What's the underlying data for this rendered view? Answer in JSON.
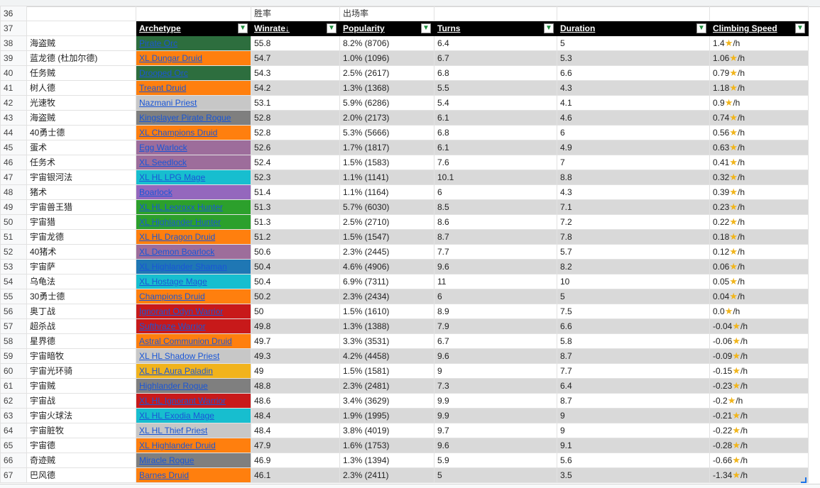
{
  "sub_headers": [
    "",
    "",
    "",
    "胜率",
    "出场率",
    "",
    "",
    ""
  ],
  "headers": [
    "Archetype",
    "Winrate↓",
    "Popularity",
    "Turns",
    "Duration",
    "Climbing Speed"
  ],
  "speed_suffix": "/h",
  "colors": {
    "dark_green": "#2d6e3e",
    "orange": "#ff7f0e",
    "light_gray": "#c7c7c7",
    "dark_gray": "#7f7f7f",
    "purple": "#9467bd",
    "mauve": "#9d6d9b",
    "cyan": "#17becf",
    "green": "#2ca02c",
    "steel_blue": "#1f77b4",
    "red": "#c8191a",
    "yellow": "#f1b31c"
  },
  "rows": [
    {
      "num": "36",
      "cn": "",
      "arch": "",
      "color": "",
      "winrate": "",
      "popularity": "",
      "turns": "",
      "duration": "",
      "speed": ""
    },
    {
      "num": "37",
      "cn": "",
      "header": true
    },
    {
      "num": "38",
      "cn": "海盗贼",
      "arch": "Pirate Orc",
      "color": "dark_green",
      "winrate": "55.8",
      "popularity": "8.2% (8706)",
      "turns": "6.4",
      "duration": "5",
      "speed": "1.4"
    },
    {
      "num": "39",
      "cn": "蓝龙德 (杜加尔德)",
      "arch": "XL Dungar Druid",
      "color": "orange",
      "winrate": "54.7",
      "popularity": "1.0% (1096)",
      "turns": "6.7",
      "duration": "5.3",
      "speed": "1.06"
    },
    {
      "num": "40",
      "cn": "任务贼",
      "arch": "Drooped Orc",
      "color": "dark_green",
      "winrate": "54.3",
      "popularity": "2.5% (2617)",
      "turns": "6.8",
      "duration": "6.6",
      "speed": "0.79"
    },
    {
      "num": "41",
      "cn": "树人德",
      "arch": "Treant Druid",
      "color": "orange",
      "winrate": "54.2",
      "popularity": "1.3% (1368)",
      "turns": "5.5",
      "duration": "4.3",
      "speed": "1.18"
    },
    {
      "num": "42",
      "cn": "光速牧",
      "arch": "Nazmani Priest",
      "color": "light_gray",
      "winrate": "53.1",
      "popularity": "5.9% (6286)",
      "turns": "5.4",
      "duration": "4.1",
      "speed": "0.9"
    },
    {
      "num": "43",
      "cn": "海盗贼",
      "arch": "Kingslayer Pirate Rogue",
      "color": "dark_gray",
      "winrate": "52.8",
      "popularity": "2.0% (2173)",
      "turns": "6.1",
      "duration": "4.6",
      "speed": "0.74"
    },
    {
      "num": "44",
      "cn": "40勇士德",
      "arch": "XL Champions Druid",
      "color": "orange",
      "winrate": "52.8",
      "popularity": "5.3% (5666)",
      "turns": "6.8",
      "duration": "6",
      "speed": "0.56"
    },
    {
      "num": "45",
      "cn": "蛋术",
      "arch": "Egg Warlock",
      "color": "mauve",
      "winrate": "52.6",
      "popularity": "1.7% (1817)",
      "turns": "6.1",
      "duration": "4.9",
      "speed": "0.63"
    },
    {
      "num": "46",
      "cn": "任务术",
      "arch": "XL Seedlock",
      "color": "mauve",
      "winrate": "52.4",
      "popularity": "1.5% (1583)",
      "turns": "7.6",
      "duration": "7",
      "speed": "0.41"
    },
    {
      "num": "47",
      "cn": "宇宙银河法",
      "arch": "XL HL LPG Mage",
      "color": "cyan",
      "winrate": "52.3",
      "popularity": "1.1% (1141)",
      "turns": "10.1",
      "duration": "8.8",
      "speed": "0.32"
    },
    {
      "num": "48",
      "cn": "猪术",
      "arch": "Boarlock",
      "color": "purple",
      "winrate": "51.4",
      "popularity": "1.1% (1164)",
      "turns": "6",
      "duration": "4.3",
      "speed": "0.39"
    },
    {
      "num": "49",
      "cn": "宇宙兽王猎",
      "arch": "XL HL Leoroxx Hunter",
      "color": "green",
      "winrate": "51.3",
      "popularity": "5.7% (6030)",
      "turns": "8.5",
      "duration": "7.1",
      "speed": "0.23"
    },
    {
      "num": "50",
      "cn": "宇宙猎",
      "arch": "XL Highlander Hunter",
      "color": "green",
      "winrate": "51.3",
      "popularity": "2.5% (2710)",
      "turns": "8.6",
      "duration": "7.2",
      "speed": "0.22"
    },
    {
      "num": "51",
      "cn": "宇宙龙德",
      "arch": "XL HL Dragon Druid",
      "color": "orange",
      "winrate": "51.2",
      "popularity": "1.5% (1547)",
      "turns": "8.7",
      "duration": "7.8",
      "speed": "0.18"
    },
    {
      "num": "52",
      "cn": "40猪术",
      "arch": "XL Demon Boarlock",
      "color": "mauve",
      "winrate": "50.6",
      "popularity": "2.3% (2445)",
      "turns": "7.7",
      "duration": "5.7",
      "speed": "0.12"
    },
    {
      "num": "53",
      "cn": "宇宙萨",
      "arch": "XL Highlander Shaman",
      "color": "steel_blue",
      "winrate": "50.4",
      "popularity": "4.6% (4906)",
      "turns": "9.6",
      "duration": "8.2",
      "speed": "0.06"
    },
    {
      "num": "54",
      "cn": "乌龟法",
      "arch": "XL Hostage Mage",
      "color": "cyan",
      "winrate": "50.4",
      "popularity": "6.9% (7311)",
      "turns": "11",
      "duration": "10",
      "speed": "0.05"
    },
    {
      "num": "55",
      "cn": "30勇士德",
      "arch": "Champions Druid",
      "color": "orange",
      "winrate": "50.2",
      "popularity": "2.3% (2434)",
      "turns": "6",
      "duration": "5",
      "speed": "0.04"
    },
    {
      "num": "56",
      "cn": "奥丁战",
      "arch": "Ignorant Odyn Warrior",
      "color": "red",
      "winrate": "50",
      "popularity": "1.5% (1610)",
      "turns": "8.9",
      "duration": "7.5",
      "speed": "0.0"
    },
    {
      "num": "57",
      "cn": "超杀战",
      "arch": "Sufthraze Warrior",
      "color": "red",
      "winrate": "49.8",
      "popularity": "1.3% (1388)",
      "turns": "7.9",
      "duration": "6.6",
      "speed": "-0.04"
    },
    {
      "num": "58",
      "cn": "星界德",
      "arch": "Astral Communion Druid",
      "color": "orange",
      "winrate": "49.7",
      "popularity": "3.3% (3531)",
      "turns": "6.7",
      "duration": "5.8",
      "speed": "-0.06"
    },
    {
      "num": "59",
      "cn": "宇宙暗牧",
      "arch": "XL HL Shadow Priest",
      "color": "light_gray",
      "winrate": "49.3",
      "popularity": "4.2% (4458)",
      "turns": "9.6",
      "duration": "8.7",
      "speed": "-0.09"
    },
    {
      "num": "60",
      "cn": "宇宙光环骑",
      "arch": "XL HL Aura Paladin",
      "color": "yellow",
      "winrate": "49",
      "popularity": "1.5% (1581)",
      "turns": "9",
      "duration": "7.7",
      "speed": "-0.15"
    },
    {
      "num": "61",
      "cn": "宇宙贼",
      "arch": "Highlander Rogue",
      "color": "dark_gray",
      "winrate": "48.8",
      "popularity": "2.3% (2481)",
      "turns": "7.3",
      "duration": "6.4",
      "speed": "-0.23"
    },
    {
      "num": "62",
      "cn": "宇宙战",
      "arch": "XL HL Ignorant Warrior",
      "color": "red",
      "winrate": "48.6",
      "popularity": "3.4% (3629)",
      "turns": "9.9",
      "duration": "8.7",
      "speed": "-0.2"
    },
    {
      "num": "63",
      "cn": "宇宙火球法",
      "arch": "XL HL Exodia Mage",
      "color": "cyan",
      "winrate": "48.4",
      "popularity": "1.9% (1995)",
      "turns": "9.9",
      "duration": "9",
      "speed": "-0.21"
    },
    {
      "num": "64",
      "cn": "宇宙脏牧",
      "arch": "XL HL Thief Priest",
      "color": "light_gray",
      "winrate": "48.4",
      "popularity": "3.8% (4019)",
      "turns": "9.7",
      "duration": "9",
      "speed": "-0.22"
    },
    {
      "num": "65",
      "cn": "宇宙德",
      "arch": "XL Highlander Druid",
      "color": "orange",
      "winrate": "47.9",
      "popularity": "1.6% (1753)",
      "turns": "9.6",
      "duration": "9.1",
      "speed": "-0.28"
    },
    {
      "num": "66",
      "cn": "奇迹贼",
      "arch": "Miracle Rogue",
      "color": "dark_gray",
      "winrate": "46.9",
      "popularity": "1.3% (1394)",
      "turns": "5.9",
      "duration": "5.6",
      "speed": "-0.66"
    },
    {
      "num": "67",
      "cn": "巴风德",
      "arch": "Barnes Druid",
      "color": "orange",
      "winrate": "46.1",
      "popularity": "2.3% (2411)",
      "turns": "5",
      "duration": "3.5",
      "speed": "-1.34"
    }
  ]
}
